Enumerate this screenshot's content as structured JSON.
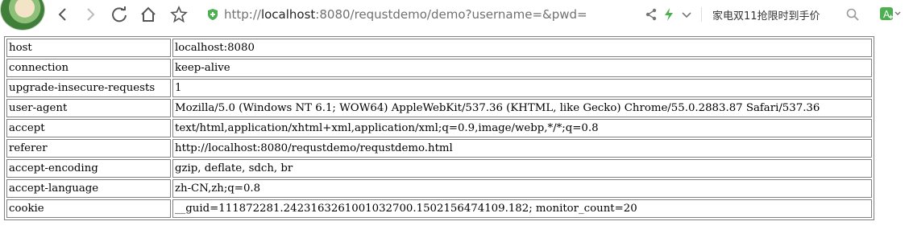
{
  "browser": {
    "url": {
      "scheme": "http://",
      "host": "localhost",
      "rest": ":8080/requstdemo/demo?username=&pwd="
    },
    "promo_text": "家电双11抢限时到手价",
    "icons": {
      "back": "arrow-left-icon",
      "forward": "arrow-right-icon",
      "reload": "reload-icon",
      "home": "home-icon",
      "bookmark": "star-icon",
      "security": "shield-icon",
      "share": "share-icon",
      "speed": "lightning-icon",
      "dropdown": "chevron-down-icon",
      "search": "search-icon",
      "translate": "translate-icon"
    },
    "accent_color": "#4caf50"
  },
  "headers": [
    {
      "name": "host",
      "value": "localhost:8080"
    },
    {
      "name": "connection",
      "value": "keep-alive"
    },
    {
      "name": "upgrade-insecure-requests",
      "value": "1"
    },
    {
      "name": "user-agent",
      "value": "Mozilla/5.0 (Windows NT 6.1; WOW64) AppleWebKit/537.36 (KHTML, like Gecko) Chrome/55.0.2883.87 Safari/537.36"
    },
    {
      "name": "accept",
      "value": "text/html,application/xhtml+xml,application/xml;q=0.9,image/webp,*/*;q=0.8"
    },
    {
      "name": "referer",
      "value": "http://localhost:8080/requstdemo/requstdemo.html"
    },
    {
      "name": "accept-encoding",
      "value": "gzip, deflate, sdch, br"
    },
    {
      "name": "accept-language",
      "value": "zh-CN,zh;q=0.8"
    },
    {
      "name": "cookie",
      "value": "__guid=111872281.2423163261001032700.1502156474109.182; monitor_count=20"
    }
  ]
}
